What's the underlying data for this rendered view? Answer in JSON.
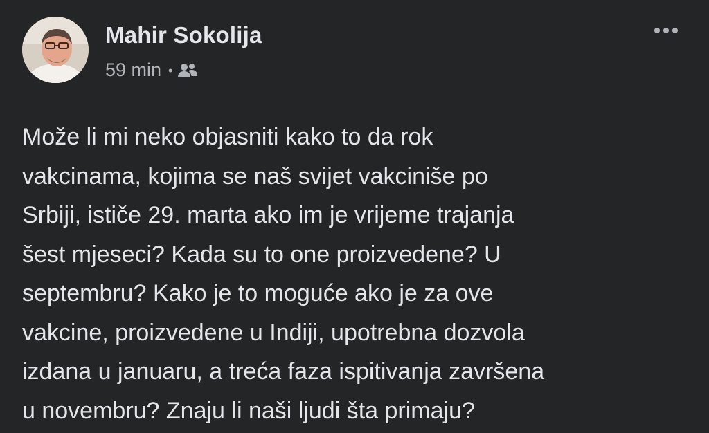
{
  "post": {
    "author": "Mahir Sokolija",
    "timestamp": "59 min",
    "separator": "•",
    "audience_icon": "friends-icon",
    "more_icon": "more-options-icon",
    "avatar_icon": "profile-photo",
    "body_lines": [
      "Može li mi neko objasniti kako to da rok",
      "vakcinama, kojima se naš svijet vakciniše po",
      "Srbiji, ističe 29. marta ako im je vrijeme trajanja",
      "šest mjeseci? Kada su to one proizvedene? U",
      "septembru? Kako je to moguće ako je za ove",
      "vakcine, proizvedene u Indiji, upotrebna dozvola",
      "izdana u januaru, a treća faza ispitivanja završena",
      "u novembru? Znaju li naši ljudi šta primaju?"
    ]
  },
  "colors": {
    "background": "#242526",
    "primary_text": "#e4e6eb",
    "secondary_text": "#b0b3b8"
  }
}
